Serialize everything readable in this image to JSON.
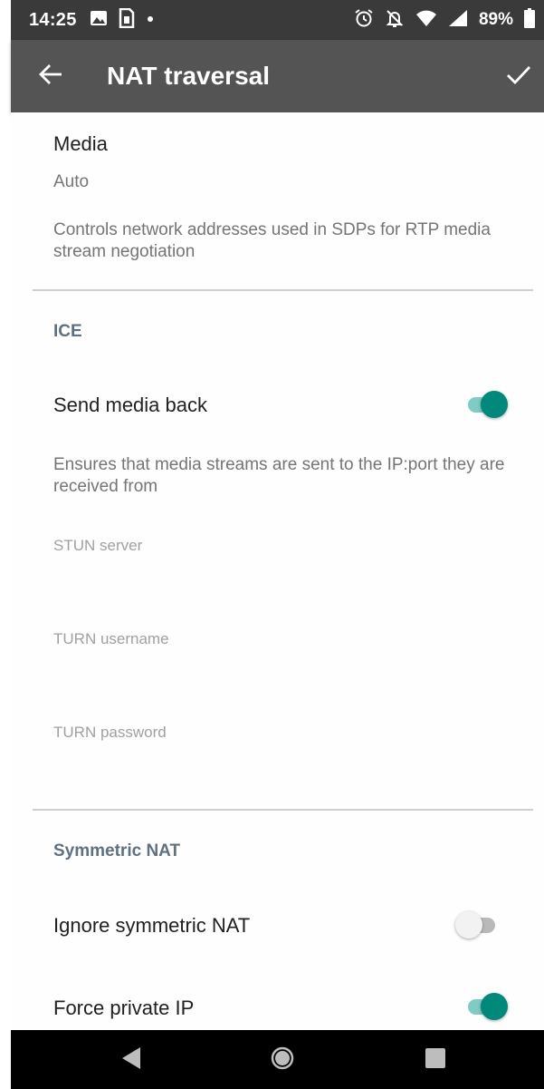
{
  "status_bar": {
    "time": "14:25",
    "battery_percent": "89%",
    "left_icons": [
      "image-icon",
      "sim-icon",
      "dot-icon"
    ],
    "right_icons": [
      "alarm-icon",
      "notifications-off-icon",
      "wifi-icon",
      "signal-icon",
      "battery-icon"
    ]
  },
  "app_bar": {
    "title": "NAT traversal",
    "back_icon": "arrow-back-icon",
    "confirm_icon": "check-icon"
  },
  "media": {
    "title": "Media",
    "value": "Auto",
    "description": "Controls network addresses used in SDPs for RTP media stream negotiation"
  },
  "ice": {
    "category": "ICE",
    "send_media_back": {
      "title": "Send media back",
      "description": "Ensures that media streams are sent to the IP:port they are received from",
      "checked": true
    },
    "stun_server": {
      "placeholder": "STUN server"
    },
    "turn_username": {
      "placeholder": "TURN username"
    },
    "turn_password": {
      "placeholder": "TURN password"
    }
  },
  "symmetric_nat": {
    "category": "Symmetric NAT",
    "ignore": {
      "title": "Ignore symmetric NAT",
      "checked": false
    },
    "force_private_ip": {
      "title": "Force private IP",
      "checked": true
    }
  },
  "colors": {
    "status_bar": "#3a3a3a",
    "app_bar": "#545454",
    "accent": "#00897b",
    "category_text": "#5f7180"
  }
}
